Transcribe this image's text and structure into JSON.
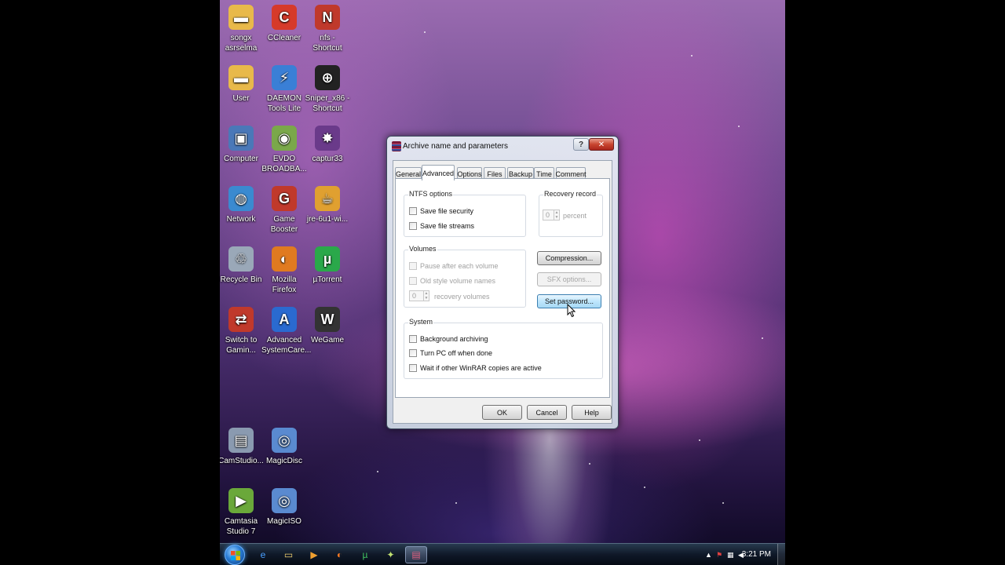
{
  "desktop_icons": [
    {
      "label": "songx asrselma",
      "icon": "folder-icon",
      "color": "#e8b94a"
    },
    {
      "label": "CCleaner",
      "icon": "ccleaner-icon",
      "color": "#d63a2a"
    },
    {
      "label": "nfs - Shortcut",
      "icon": "nfs-icon",
      "color": "#c0392b"
    },
    {
      "label": "User",
      "icon": "user-folder-icon",
      "color": "#e8b94a"
    },
    {
      "label": "DAEMON Tools Lite",
      "icon": "daemon-tools-icon",
      "color": "#3a7fd6"
    },
    {
      "label": "Sniper_x86 - Shortcut",
      "icon": "sniper-icon",
      "color": "#222222"
    },
    {
      "label": "Computer",
      "icon": "computer-icon",
      "color": "#4a78b8"
    },
    {
      "label": "EVDO BROADBA...",
      "icon": "evdo-icon",
      "color": "#7aa84a"
    },
    {
      "label": "captur33",
      "icon": "image-file-icon",
      "color": "#6a3a8a"
    },
    {
      "label": "Network",
      "icon": "network-icon",
      "color": "#3a8ad0"
    },
    {
      "label": "Game Booster",
      "icon": "game-booster-icon",
      "color": "#c0392b"
    },
    {
      "label": "jre-6u1-wi...",
      "icon": "java-installer-icon",
      "color": "#e0a030"
    },
    {
      "label": "Recycle Bin",
      "icon": "recycle-bin-icon",
      "color": "#9aa8b8"
    },
    {
      "label": "Mozilla Firefox",
      "icon": "firefox-icon",
      "color": "#e07a20"
    },
    {
      "label": "µTorrent",
      "icon": "utorrent-icon",
      "color": "#2aa84a"
    },
    {
      "label": "Switch to Gamin...",
      "icon": "switch-gaming-icon",
      "color": "#c0392b"
    },
    {
      "label": "Advanced SystemCare...",
      "icon": "advanced-systemcare-icon",
      "color": "#2a6ad0"
    },
    {
      "label": "WeGame",
      "icon": "wegame-icon",
      "color": "#333333"
    },
    {
      "label": "CamStudio...",
      "icon": "camstudio-icon",
      "color": "#8a9ab0"
    },
    {
      "label": "MagicDisc",
      "icon": "magicdisc-icon",
      "color": "#5a8ad0"
    },
    {
      "label": "Camtasia Studio 7",
      "icon": "camtasia-icon",
      "color": "#6aa83a"
    },
    {
      "label": "MagicISO",
      "icon": "magiciso-icon",
      "color": "#5a8ad0"
    }
  ],
  "taskbar": {
    "items": [
      {
        "icon": "internet-explorer-icon",
        "active": false
      },
      {
        "icon": "file-explorer-icon",
        "active": false
      },
      {
        "icon": "media-player-icon",
        "active": false
      },
      {
        "icon": "firefox-icon",
        "active": false
      },
      {
        "icon": "utorrent-icon",
        "active": false
      },
      {
        "icon": "utility-icon",
        "active": false
      },
      {
        "icon": "winrar-icon",
        "active": true
      }
    ],
    "clock": "3:21 PM"
  },
  "dialog": {
    "title": "Archive name and parameters",
    "help_caption": "?",
    "close_caption": "✕",
    "tabs": [
      "General",
      "Advanced",
      "Options",
      "Files",
      "Backup",
      "Time",
      "Comment"
    ],
    "selected_tab": "Advanced",
    "ntfs": {
      "title": "NTFS options",
      "save_security": "Save file security",
      "save_streams": "Save file streams"
    },
    "recovery": {
      "title": "Recovery record",
      "value": "0",
      "unit": "percent"
    },
    "volumes": {
      "title": "Volumes",
      "pause": "Pause after each volume",
      "old_style": "Old style volume names",
      "value": "0",
      "unit": "recovery volumes"
    },
    "buttons": {
      "compression": "Compression...",
      "sfx": "SFX options...",
      "password": "Set password..."
    },
    "system": {
      "title": "System",
      "background": "Background archiving",
      "turn_off": "Turn PC off when done",
      "wait": "Wait if other WinRAR copies are active"
    },
    "footer": {
      "ok": "OK",
      "cancel": "Cancel",
      "help": "Help"
    }
  }
}
